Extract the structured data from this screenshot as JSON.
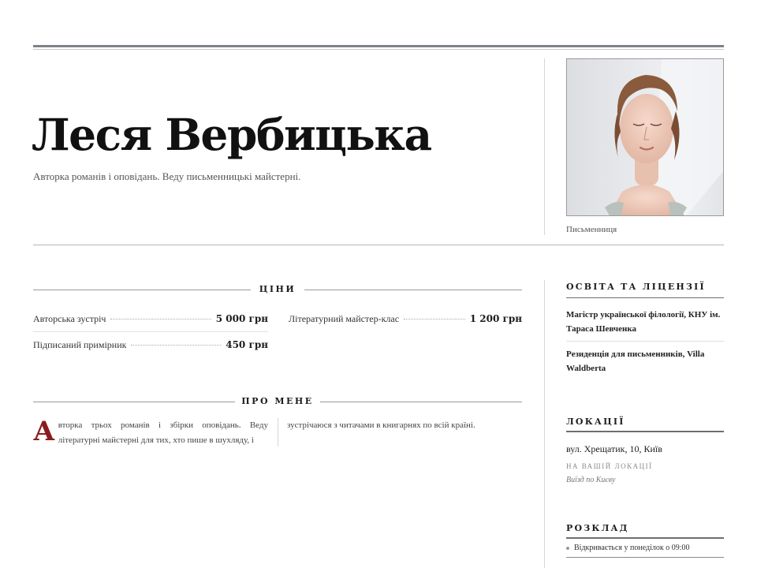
{
  "profile": {
    "name": "Леся Вербицька",
    "tagline": "Авторка романів і оповідань. Веду письменницькі майстерні.",
    "photo_caption": "Письменниця"
  },
  "prices": {
    "heading": "ЦІНИ",
    "items": [
      {
        "label": "Авторська зустріч",
        "value": "5 000 грн"
      },
      {
        "label": "Літературний майстер-клас",
        "value": "1 200 грн"
      },
      {
        "label": "Підписаний примірник",
        "value": "450 грн"
      }
    ]
  },
  "about": {
    "heading": "ПРО МЕНЕ",
    "dropcap": "А",
    "col1": "вторка трьох романів і збірки оповідань. Веду літературні майстерні для тих, хто пише в шухляду, і",
    "col2": "зустрічаюся з читачами в книгарнях по всій країні."
  },
  "sidebar": {
    "education": {
      "heading": "ОСВІТА ТА ЛІЦЕНЗІЇ",
      "items": [
        "Магістр української філології, КНУ ім. Тараса Шевченка",
        "Резиденція для письменників, Villa Waldberta"
      ]
    },
    "locations": {
      "heading": "ЛОКАЦІЇ",
      "address": "вул. Хрещатик, 10, Київ",
      "onsite_label": "НА ВАШІЙ ЛОКАЦІЇ",
      "onsite_note": "Виїзд по Києву"
    },
    "schedule": {
      "heading": "РОЗКЛАД",
      "items": [
        "Відкривається у понеділок о 09:00"
      ]
    }
  },
  "colors": {
    "accent": "#8b1c1c",
    "rule": "#7e8186"
  }
}
